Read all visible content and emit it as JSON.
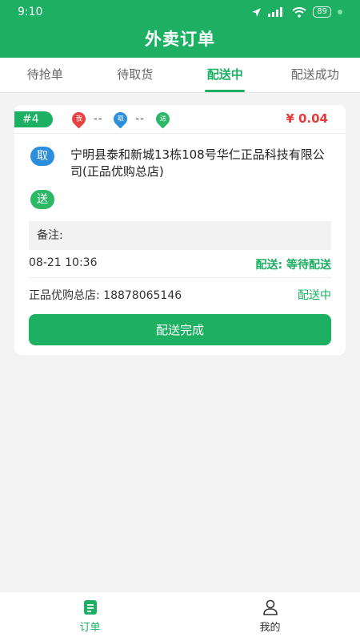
{
  "status_bar": {
    "time": "9:10",
    "battery": "89"
  },
  "header": {
    "title": "外卖订单"
  },
  "tabs": [
    {
      "label": "待抢单"
    },
    {
      "label": "待取货"
    },
    {
      "label": "配送中",
      "active": true
    },
    {
      "label": "配送成功"
    }
  ],
  "order": {
    "number": "#4",
    "route": {
      "me_label": "我",
      "pickup_label": "取",
      "deliver_label": "送",
      "dist1": "--",
      "dist2": "--"
    },
    "price": "¥ 0.04",
    "pickup_tag": "取",
    "pickup_address": "宁明县泰和新城13栋108号华仁正品科技有限公司(正品优购总店)",
    "deliver_tag": "送",
    "note_label": "备注:",
    "time": "08-21 10:36",
    "delivery_status": "配送: 等待配送",
    "store_phone": "正品优购总店: 18878065146",
    "state": "配送中",
    "action_button": "配送完成"
  },
  "bottom_nav": [
    {
      "label": "订单",
      "icon": "order-list-icon",
      "active": true
    },
    {
      "label": "我的",
      "icon": "user-icon"
    }
  ],
  "colors": {
    "primary": "#1db063",
    "price": "#e53b3b",
    "pin_red": "#e64242",
    "pin_blue": "#2b8fdc",
    "pin_green": "#2cb866"
  }
}
